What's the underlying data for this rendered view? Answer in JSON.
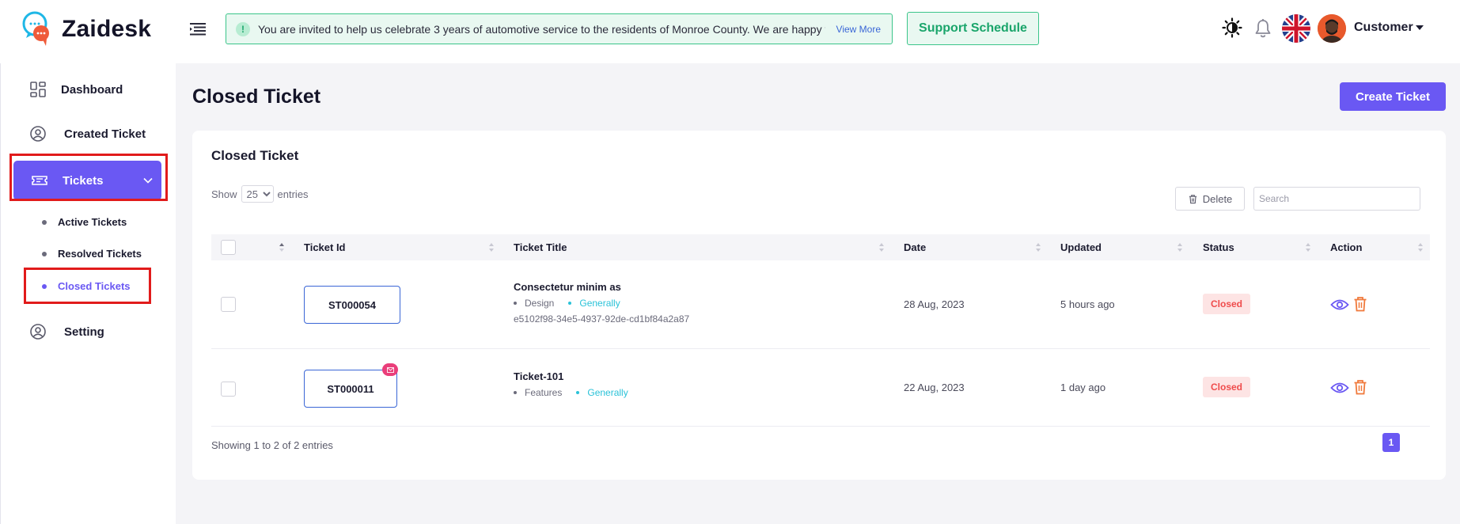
{
  "brand": {
    "name": "Zaidesk"
  },
  "header": {
    "notice_text": "You are invited to help us celebrate 3 years of automotive service to the residents of Monroe County. We are happy to be",
    "notice_link": "View More",
    "support_label": "Support Schedule",
    "user_name": "Customer",
    "icons": [
      "menu-icon",
      "theme-toggle-icon",
      "bell-icon",
      "uk-flag",
      "avatar"
    ]
  },
  "sidebar": {
    "items": [
      {
        "label": "Dashboard",
        "icon": "dashboard-grid-icon"
      },
      {
        "label": "Created Ticket",
        "icon": "user-circle-icon"
      },
      {
        "label": "Tickets",
        "icon": "ticket-icon",
        "active": true,
        "expanded": true
      },
      {
        "label": "Setting",
        "icon": "user-circle-icon"
      }
    ],
    "sub_items": [
      {
        "label": "Active Tickets"
      },
      {
        "label": "Resolved Tickets"
      },
      {
        "label": "Closed Tickets",
        "active": true
      }
    ]
  },
  "page": {
    "title": "Closed Ticket",
    "create_label": "Create Ticket"
  },
  "card": {
    "title": "Closed Ticket",
    "show_label": "Show",
    "entries_value": "25",
    "entries_label": "entries",
    "delete_label": "Delete",
    "search_placeholder": "Search",
    "columns": [
      "Ticket Id",
      "Ticket Title",
      "Date",
      "Updated",
      "Status",
      "Action"
    ],
    "rows": [
      {
        "id": "ST000054",
        "title": "Consectetur minim as",
        "category": "Design",
        "priority": "Generally",
        "uuid": "e5102f98-34e5-4937-92de-cd1bf84a2a87",
        "date": "28 Aug, 2023",
        "updated": "5 hours ago",
        "status": "Closed",
        "has_mail_badge": false
      },
      {
        "id": "ST000011",
        "title": "Ticket-101",
        "category": "Features",
        "priority": "Generally",
        "uuid": "",
        "date": "22 Aug, 2023",
        "updated": "1 day ago",
        "status": "Closed",
        "has_mail_badge": true
      }
    ],
    "footer_text": "Showing 1 to 2 of 2 entries",
    "current_page": "1"
  },
  "colors": {
    "accent": "#6a58f3",
    "success": "#3bc58a",
    "danger": "#ef4c4c",
    "highlight": "#e11b1b"
  }
}
